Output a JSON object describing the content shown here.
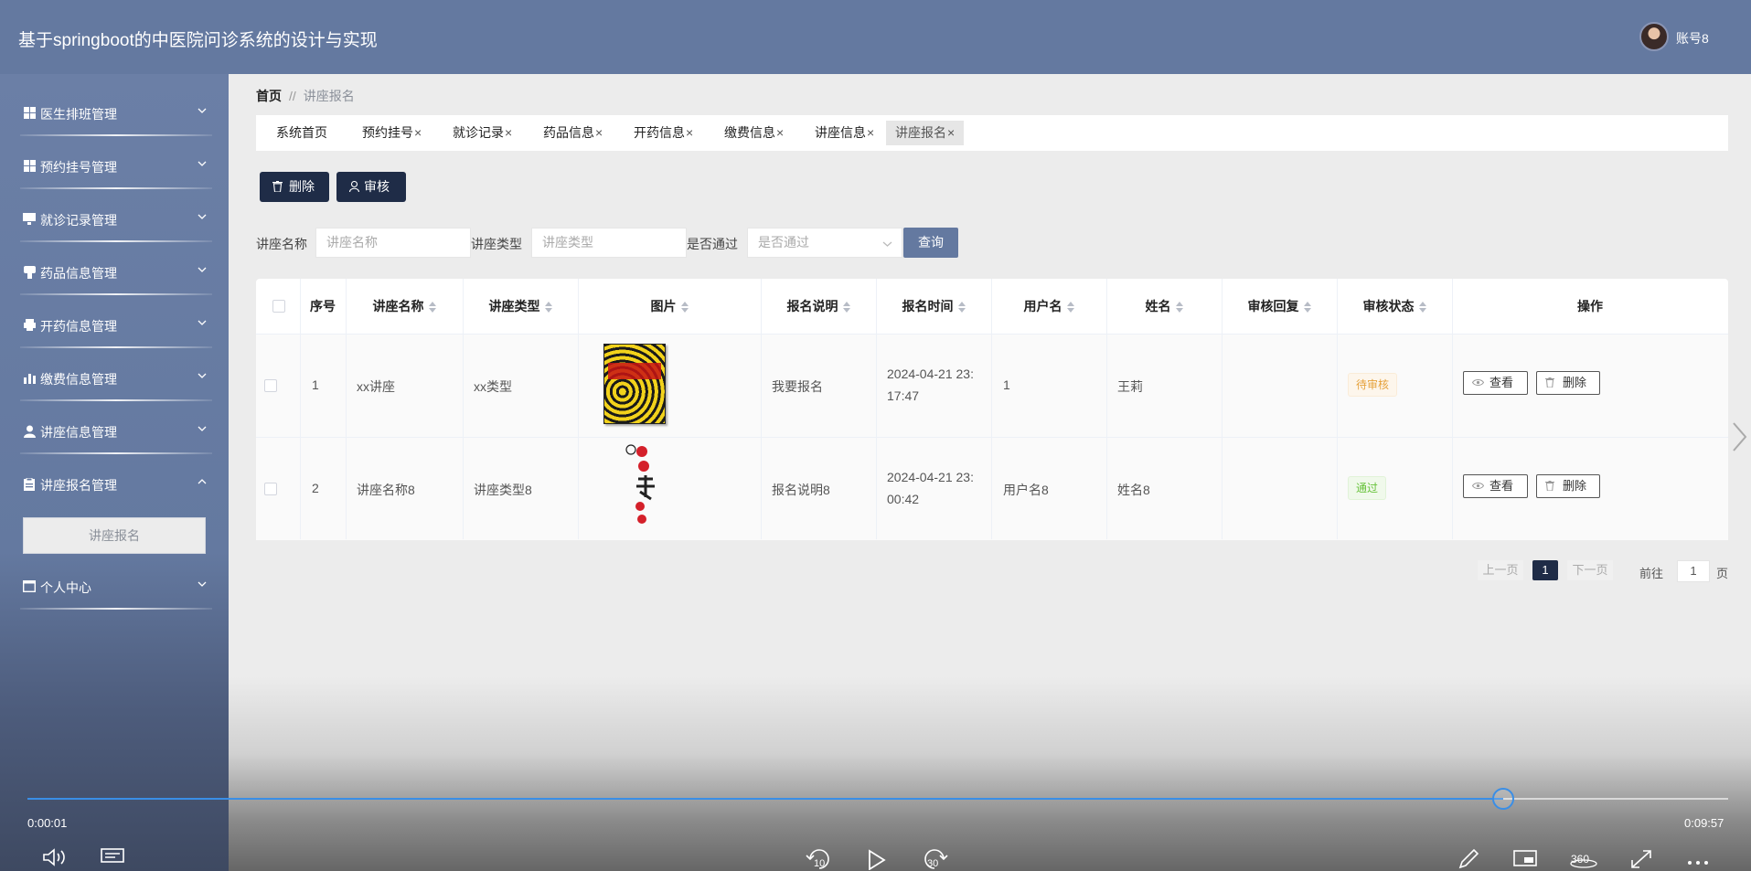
{
  "app": {
    "title": "基于springboot的中医院问诊系统的设计与实现",
    "user_name": "账号8"
  },
  "sidebar": {
    "items": [
      {
        "label": "医生排班管理",
        "icon": "grid-icon"
      },
      {
        "label": "预约挂号管理",
        "icon": "grid-icon"
      },
      {
        "label": "就诊记录管理",
        "icon": "monitor-icon"
      },
      {
        "label": "药品信息管理",
        "icon": "pill-icon"
      },
      {
        "label": "开药信息管理",
        "icon": "printer-icon"
      },
      {
        "label": "缴费信息管理",
        "icon": "bar-chart-icon"
      },
      {
        "label": "讲座信息管理",
        "icon": "user-icon"
      },
      {
        "label": "讲座报名管理",
        "icon": "clipboard-icon"
      },
      {
        "label": "个人中心",
        "icon": "window-icon"
      }
    ],
    "submenu_active": "讲座报名"
  },
  "breadcrumb": {
    "home": "首页",
    "separator": "//",
    "current": "讲座报名"
  },
  "tabs": [
    {
      "label": "系统首页",
      "closable": false
    },
    {
      "label": "预约挂号",
      "closable": true
    },
    {
      "label": "就诊记录",
      "closable": true
    },
    {
      "label": "药品信息",
      "closable": true
    },
    {
      "label": "开药信息",
      "closable": true
    },
    {
      "label": "缴费信息",
      "closable": true
    },
    {
      "label": "讲座信息",
      "closable": true
    },
    {
      "label": "讲座报名",
      "closable": true
    }
  ],
  "tab_close_glyph": "×",
  "actions": {
    "delete_label": "删除",
    "audit_label": "审核"
  },
  "search": {
    "name_label": "讲座名称",
    "name_placeholder": "讲座名称",
    "type_label": "讲座类型",
    "type_placeholder": "讲座类型",
    "pass_label": "是否通过",
    "pass_placeholder": "是否通过",
    "query_label": "查询"
  },
  "table": {
    "headers": [
      "序号",
      "讲座名称",
      "讲座类型",
      "图片",
      "报名说明",
      "报名时间",
      "用户名",
      "姓名",
      "审核回复",
      "审核状态",
      "操作"
    ],
    "rows": [
      {
        "index": "1",
        "name": "xx讲座",
        "type": "xx类型",
        "desc": "我要报名",
        "time_line1": "2024-04-21 23:",
        "time_line2": "17:47",
        "username": "1",
        "realname": "王莉",
        "reply": "",
        "status": "待审核"
      },
      {
        "index": "2",
        "name": "讲座名称8",
        "type": "讲座类型8",
        "desc": "报名说明8",
        "time_line1": "2024-04-21 23:",
        "time_line2": "00:42",
        "username": "用户名8",
        "realname": "姓名8",
        "reply": "",
        "status": "通过"
      }
    ],
    "view_label": "查看",
    "delete_label": "删除"
  },
  "pagination": {
    "prev": "上一页",
    "current": "1",
    "next": "下一页",
    "goto_label": "前往",
    "goto_value": "1",
    "page_unit": "页"
  },
  "player": {
    "elapsed": "0:00:01",
    "total": "0:09:57",
    "progress": 0.868,
    "rewind_label": "10",
    "forward_label": "30",
    "view_label": "360"
  },
  "colors": {
    "header": "#6479a0",
    "dark_button": "#1f2c47",
    "progress": "#3a8ee6",
    "pending": "#e6a23c",
    "ok": "#67c23a"
  }
}
